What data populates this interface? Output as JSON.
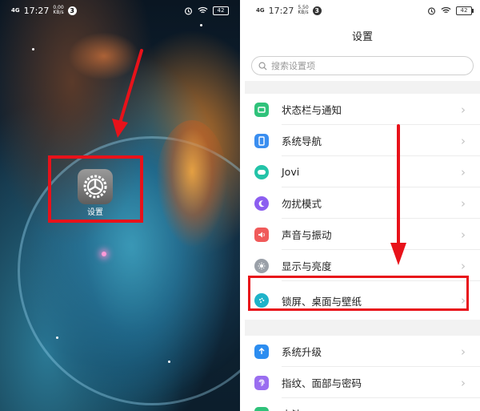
{
  "left": {
    "status_bar": {
      "signal": "4G",
      "time": "17:27",
      "net_speed_value": "0.00",
      "net_speed_unit": "KB/s",
      "notification_count": "3",
      "battery": "42"
    },
    "app": {
      "label": "设置"
    }
  },
  "right": {
    "status_bar": {
      "signal": "4G",
      "time": "17:27",
      "net_speed_value": "5.50",
      "net_speed_unit": "KB/s",
      "notification_count": "3",
      "battery": "42"
    },
    "title": "设置",
    "search": {
      "placeholder": "搜索设置项"
    },
    "items": [
      {
        "label": "状态栏与通知",
        "icon": "status-bar-icon",
        "color": "#2fc27a"
      },
      {
        "label": "系统导航",
        "icon": "navigation-icon",
        "color": "#3a8ef0"
      },
      {
        "label": "Jovi",
        "icon": "jovi-icon",
        "color": "#23c3a8"
      },
      {
        "label": "勿扰模式",
        "icon": "moon-icon",
        "color": "#8c5ef0"
      },
      {
        "label": "声音与振动",
        "icon": "sound-icon",
        "color": "#f05a5a"
      },
      {
        "label": "显示与亮度",
        "icon": "brightness-icon",
        "color": "#9aa0a8"
      },
      {
        "label": "锁屏、桌面与壁纸",
        "icon": "palette-icon",
        "color": "#1fb3c9"
      },
      {
        "label": "系统升级",
        "icon": "system-upgrade-icon",
        "color": "#2c8df0"
      },
      {
        "label": "指纹、面部与密码",
        "icon": "fingerprint-icon",
        "color": "#9a6ef0"
      },
      {
        "label": "电池",
        "icon": "battery-icon",
        "color": "#2fc27a"
      }
    ]
  },
  "colors": {
    "highlight": "#e8121a",
    "arrow": "#e8121a"
  }
}
